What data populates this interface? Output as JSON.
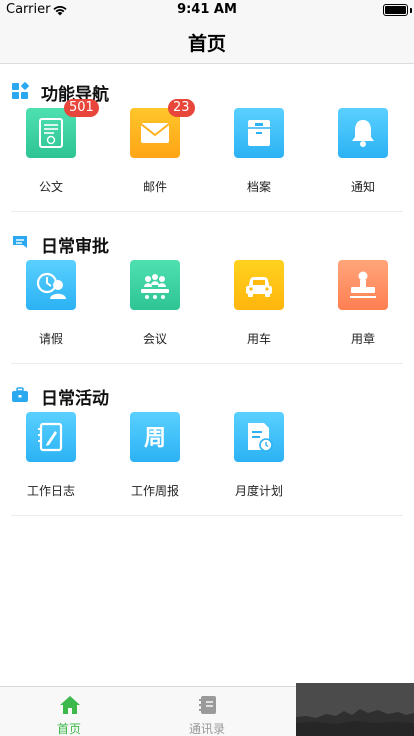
{
  "status_bar": {
    "carrier": "Carrier",
    "time": "9:41 AM"
  },
  "nav": {
    "title": "首页"
  },
  "sections": [
    {
      "title": "功能导航",
      "icon": "grid-icon",
      "items": [
        {
          "label": "公文",
          "icon": "document-icon",
          "badge": "501",
          "color_top": "#4fe0b0",
          "color_bottom": "#2ec494"
        },
        {
          "label": "邮件",
          "icon": "mail-icon",
          "badge": "23",
          "color_top": "#ffc62a",
          "color_bottom": "#ffa516"
        },
        {
          "label": "档案",
          "icon": "archive-icon",
          "badge": "",
          "color_top": "#5ad0ff",
          "color_bottom": "#2bb2f4"
        },
        {
          "label": "通知",
          "icon": "bell-icon",
          "badge": "",
          "color_top": "#5ad0ff",
          "color_bottom": "#2bb2f4"
        }
      ]
    },
    {
      "title": "日常审批",
      "icon": "message-icon",
      "items": [
        {
          "label": "请假",
          "icon": "leave-icon",
          "badge": "",
          "color_top": "#5ad0ff",
          "color_bottom": "#2bb2f4"
        },
        {
          "label": "会议",
          "icon": "meeting-icon",
          "badge": "",
          "color_top": "#4fe0b0",
          "color_bottom": "#2ec494"
        },
        {
          "label": "用车",
          "icon": "car-icon",
          "badge": "",
          "color_top": "#ffd21f",
          "color_bottom": "#ffb50d"
        },
        {
          "label": "用章",
          "icon": "stamp-icon",
          "badge": "",
          "color_top": "#ffa57a",
          "color_bottom": "#ff7f52"
        }
      ]
    },
    {
      "title": "日常活动",
      "icon": "briefcase-icon",
      "items": [
        {
          "label": "工作日志",
          "icon": "notebook-icon",
          "badge": "",
          "color_top": "#5ad0ff",
          "color_bottom": "#2bb2f4"
        },
        {
          "label": "工作周报",
          "icon": "week-icon",
          "badge": "",
          "glyph": "周",
          "color_top": "#5ad0ff",
          "color_bottom": "#2bb2f4"
        },
        {
          "label": "月度计划",
          "icon": "plan-icon",
          "badge": "",
          "color_top": "#5ad0ff",
          "color_bottom": "#2bb2f4"
        }
      ]
    }
  ],
  "tabs": [
    {
      "label": "首页",
      "icon": "home-icon",
      "active": true,
      "color": "#3cb94a"
    },
    {
      "label": "通讯录",
      "icon": "contacts-icon",
      "active": false,
      "color": "#999999"
    }
  ]
}
